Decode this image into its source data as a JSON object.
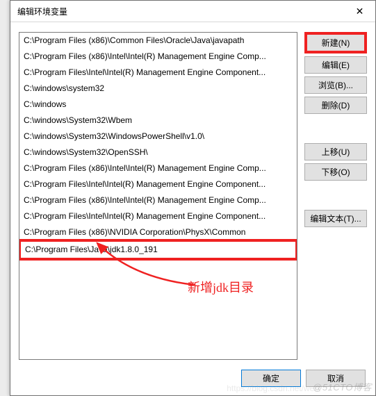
{
  "window": {
    "title": "编辑环境变量",
    "close_icon": "✕"
  },
  "path_entries": [
    "C:\\Program Files (x86)\\Common Files\\Oracle\\Java\\javapath",
    "C:\\Program Files (x86)\\Intel\\Intel(R) Management Engine Comp...",
    "C:\\Program Files\\Intel\\Intel(R) Management Engine Component...",
    "C:\\windows\\system32",
    "C:\\windows",
    "C:\\windows\\System32\\Wbem",
    "C:\\windows\\System32\\WindowsPowerShell\\v1.0\\",
    "C:\\windows\\System32\\OpenSSH\\",
    "C:\\Program Files (x86)\\Intel\\Intel(R) Management Engine Comp...",
    "C:\\Program Files\\Intel\\Intel(R) Management Engine Component...",
    "C:\\Program Files (x86)\\Intel\\Intel(R) Management Engine Comp...",
    "C:\\Program Files\\Intel\\Intel(R) Management Engine Component...",
    "C:\\Program Files (x86)\\NVIDIA Corporation\\PhysX\\Common",
    "C:\\Program Files\\Java\\jdk1.8.0_191"
  ],
  "selected_highlight_index": 13,
  "buttons": {
    "new": "新建(N)",
    "edit": "编辑(E)",
    "browse": "浏览(B)...",
    "delete": "删除(D)",
    "move_up": "上移(U)",
    "move_down": "下移(O)",
    "edit_text": "编辑文本(T)...",
    "ok": "确定",
    "cancel": "取消"
  },
  "annotation": {
    "text": "新增jdk目录"
  },
  "watermark": {
    "main": "@51CTO博客",
    "sub": "https://blog.csdn.net/weix"
  }
}
